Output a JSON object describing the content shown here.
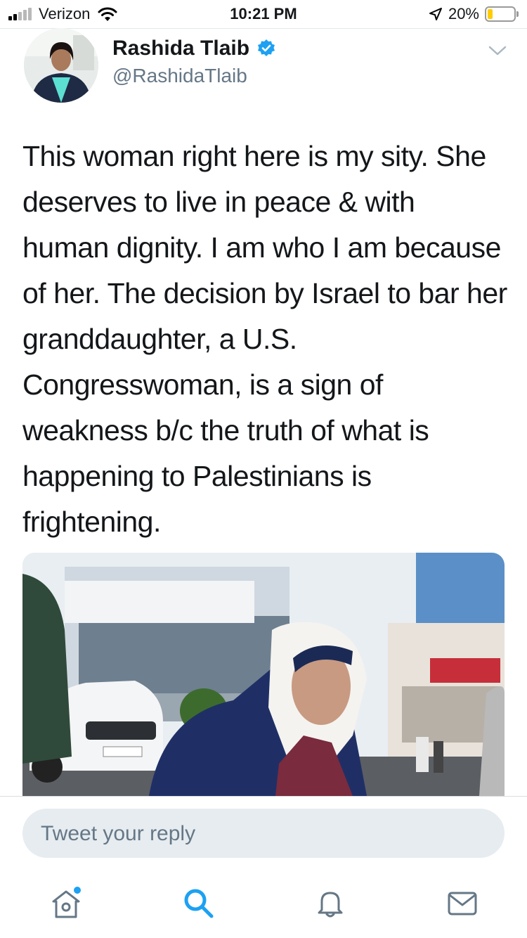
{
  "status_bar": {
    "carrier": "Verizon",
    "time": "10:21 PM",
    "battery_percent": "20%",
    "battery_level": 0.2,
    "signal_bars": 2
  },
  "tweet": {
    "author_name": "Rashida Tlaib",
    "handle": "@RashidaTlaib",
    "text": "This woman right here is my sity. She deserves to live in peace & with human dignity. I am who I am because of her. The decision by Israel to bar her granddaughter, a U.S. Congresswoman, is a sign of weakness b/c the truth of what is happening to Palestinians is frightening.",
    "verified": true
  },
  "reply": {
    "placeholder": "Tweet your reply"
  },
  "tab_bar": {
    "items": [
      "home-icon",
      "search-icon",
      "notifications-icon",
      "messages-icon"
    ],
    "home_has_dot": true
  },
  "colors": {
    "accent": "#1da1f2",
    "secondary_text": "#657786",
    "reply_bg": "#e6ecf0",
    "battery": "#ffcc00"
  }
}
